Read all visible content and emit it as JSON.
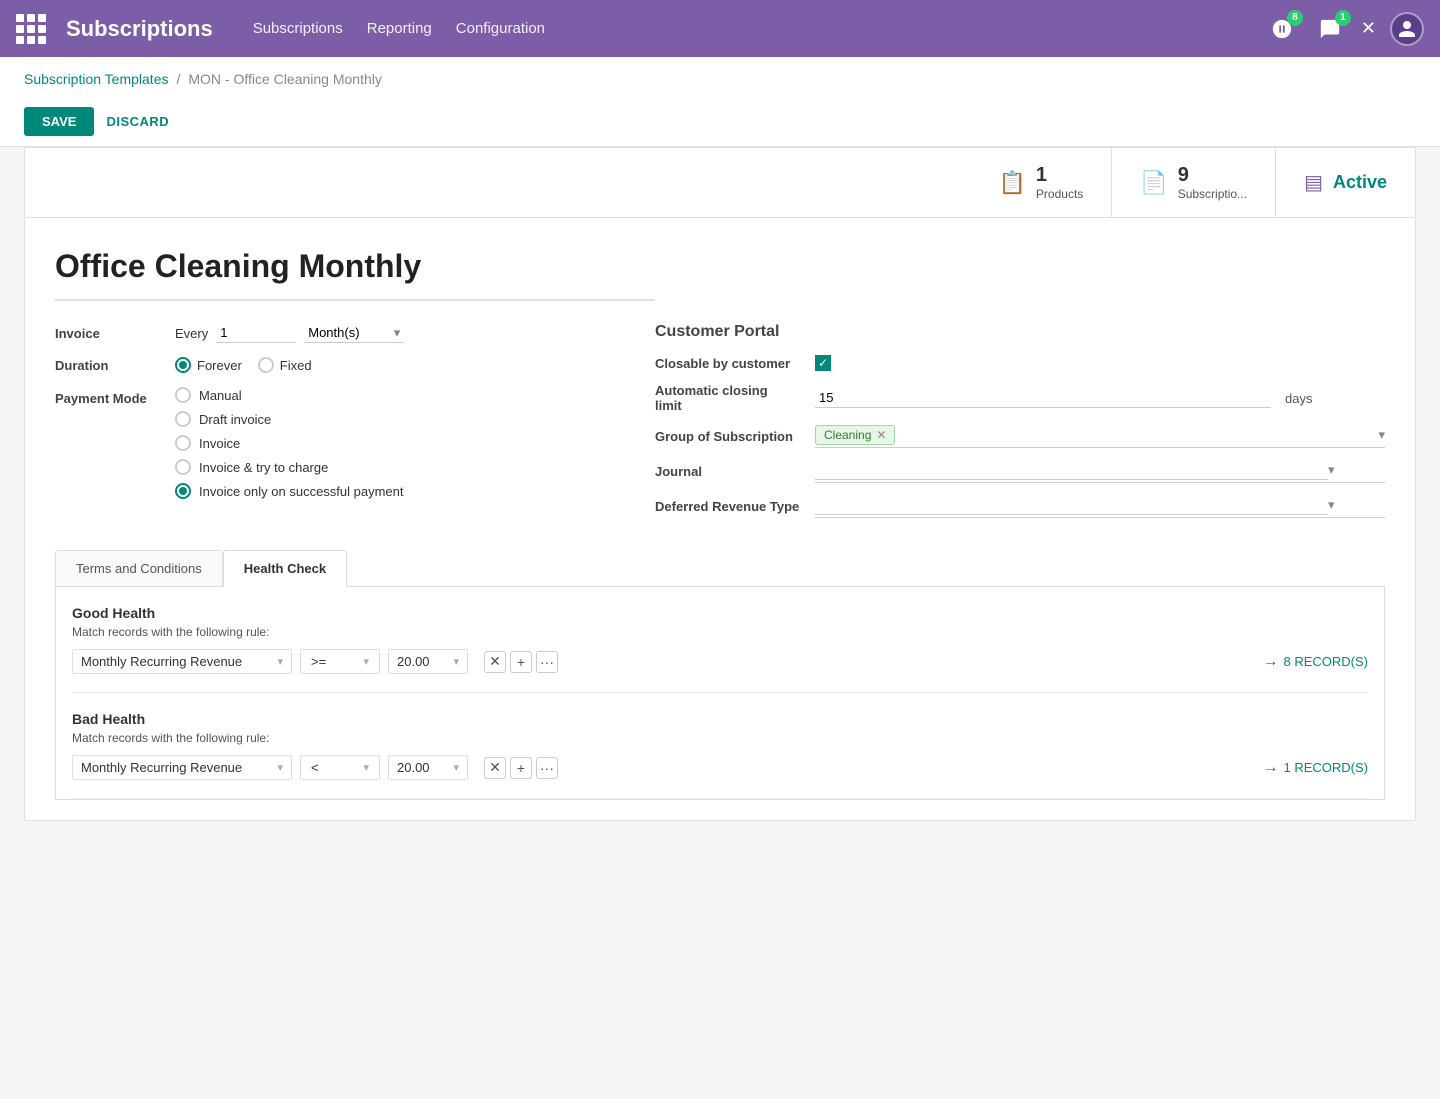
{
  "topnav": {
    "brand": "Subscriptions",
    "menu": [
      "Subscriptions",
      "Reporting",
      "Configuration"
    ],
    "badge_activities": "8",
    "badge_messages": "1"
  },
  "breadcrumb": {
    "parent": "Subscription Templates",
    "separator": "/",
    "current": "MON - Office Cleaning Monthly"
  },
  "actions": {
    "save": "SAVE",
    "discard": "DISCARD"
  },
  "stats": {
    "products_count": "1",
    "products_label": "Products",
    "subscriptions_count": "9",
    "subscriptions_label": "Subscriptio...",
    "active_label": "Active"
  },
  "form": {
    "title": "Office Cleaning Monthly",
    "invoice_label": "Invoice",
    "invoice_every": "Every",
    "invoice_value": "1",
    "invoice_period": "Month(s)",
    "duration_label": "Duration",
    "duration_forever": "Forever",
    "duration_fixed": "Fixed",
    "payment_mode_label": "Payment Mode",
    "payment_modes": [
      {
        "label": "Manual",
        "selected": false
      },
      {
        "label": "Draft invoice",
        "selected": false
      },
      {
        "label": "Invoice",
        "selected": false
      },
      {
        "label": "Invoice & try to charge",
        "selected": false
      },
      {
        "label": "Invoice only on successful payment",
        "selected": true
      }
    ],
    "portal": {
      "title": "Customer Portal",
      "closable_label": "Closable by customer",
      "closable_checked": true,
      "auto_closing_label": "Automatic closing limit",
      "auto_closing_value": "15",
      "auto_closing_suffix": "days",
      "group_label": "Group of Subscription",
      "group_tag": "Cleaning",
      "journal_label": "Journal",
      "journal_value": "",
      "deferred_label": "Deferred Revenue Type",
      "deferred_value": ""
    }
  },
  "tabs": [
    {
      "label": "Terms and Conditions",
      "active": false
    },
    {
      "label": "Health Check",
      "active": true
    }
  ],
  "health": {
    "good": {
      "title": "Good Health",
      "description": "Match records with the following rule:",
      "records_count": "8 RECORD(S)",
      "field": "Monthly Recurring Revenue",
      "operator": ">=",
      "value": "20.00"
    },
    "bad": {
      "title": "Bad Health",
      "description": "Match records with the following rule:",
      "records_count": "1 RECORD(S)",
      "field": "Monthly Recurring Revenue",
      "operator": "<",
      "value": "20.00"
    }
  }
}
